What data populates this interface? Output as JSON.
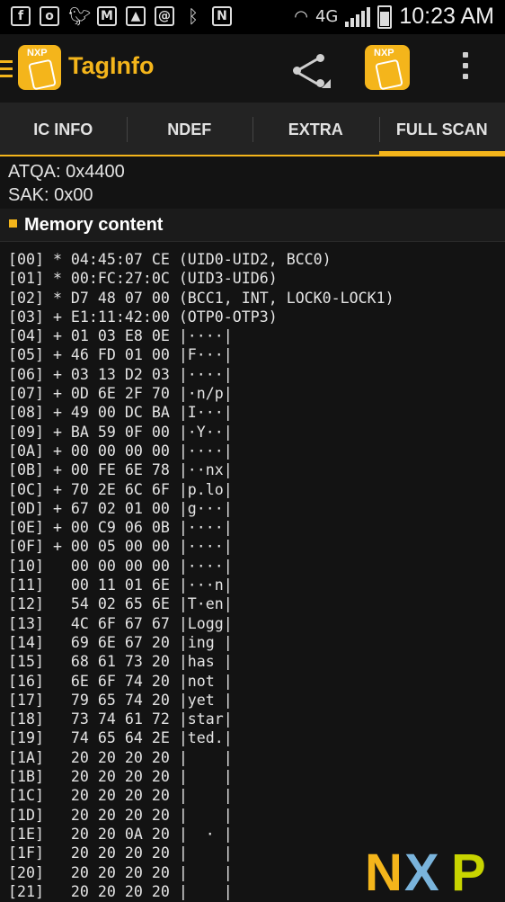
{
  "status_bar": {
    "time": "10:23 AM",
    "network": "4G",
    "icons": [
      "facebook-icon",
      "outlook-icon",
      "twitter-icon",
      "gmail-icon",
      "gallery-icon",
      "email-icon",
      "bluetooth-icon",
      "nfc-icon",
      "wifi-icon",
      "signal-icon",
      "battery-icon"
    ]
  },
  "app_bar": {
    "title": "TagInfo",
    "logo_text": "NXP"
  },
  "tabs": [
    {
      "label": "IC INFO",
      "active": false
    },
    {
      "label": "NDEF",
      "active": false
    },
    {
      "label": "EXTRA",
      "active": false
    },
    {
      "label": "FULL SCAN",
      "active": true
    }
  ],
  "info": {
    "atqa": "ATQA: 0x4400",
    "sak": "SAK: 0x00"
  },
  "section": {
    "title": "Memory content"
  },
  "memory_lines": [
    "[00] * 04:45:07 CE (UID0-UID2, BCC0)",
    "[01] * 00:FC:27:0C (UID3-UID6)",
    "[02] * D7 48 07 00 (BCC1, INT, LOCK0-LOCK1)",
    "[03] + E1:11:42:00 (OTP0-OTP3)",
    "[04] + 01 03 E8 0E |····|",
    "[05] + 46 FD 01 00 |F···|",
    "[06] + 03 13 D2 03 |····|",
    "[07] + 0D 6E 2F 70 |·n/p|",
    "[08] + 49 00 DC BA |I···|",
    "[09] + BA 59 0F 00 |·Y··|",
    "[0A] + 00 00 00 00 |····|",
    "[0B] + 00 FE 6E 78 |··nx|",
    "[0C] + 70 2E 6C 6F |p.lo|",
    "[0D] + 67 02 01 00 |g···|",
    "[0E] + 00 C9 06 0B |····|",
    "[0F] + 00 05 00 00 |····|",
    "[10]   00 00 00 00 |····|",
    "[11]   00 11 01 6E |···n|",
    "[12]   54 02 65 6E |T·en|",
    "[13]   4C 6F 67 67 |Logg|",
    "[14]   69 6E 67 20 |ing |",
    "[15]   68 61 73 20 |has |",
    "[16]   6E 6F 74 20 |not |",
    "[17]   79 65 74 20 |yet |",
    "[18]   73 74 61 72 |star|",
    "[19]   74 65 64 2E |ted.|",
    "[1A]   20 20 20 20 |    |",
    "[1B]   20 20 20 20 |    |",
    "[1C]   20 20 20 20 |    |",
    "[1D]   20 20 20 20 |    |",
    "[1E]   20 20 0A 20 |  · |",
    "[1F]   20 20 20 20 |    |",
    "[20]   20 20 20 20 |    |",
    "[21]   20 20 20 20 |    |"
  ],
  "watermark": {
    "text_n": "N",
    "text_x": "X",
    "text_p": "P"
  },
  "colors": {
    "accent": "#f4b51b",
    "background": "#131313"
  }
}
